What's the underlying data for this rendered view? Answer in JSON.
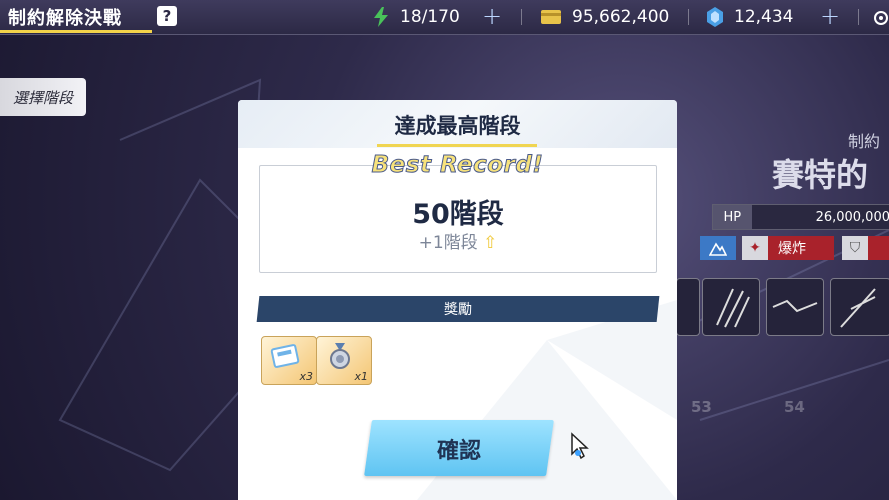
{
  "header": {
    "title": "制約解除決戰",
    "help_label": "?",
    "stamina": "18/170",
    "currency": "95,662,400",
    "gems": "12,434",
    "plus_label": "+"
  },
  "left_tab": {
    "label": "選擇階段"
  },
  "right_panel": {
    "subtitle": "制約",
    "boss_name": "賽特的",
    "hp_label": "HP",
    "hp_value": "26,000,000",
    "element_tag": "爆炸",
    "stage_numbers": [
      "53",
      "54"
    ]
  },
  "modal": {
    "title": "達成最高階段",
    "best_record": "Best Record!",
    "stage": "50階段",
    "delta": "+1階段",
    "reward_header": "獎勵",
    "rewards": [
      {
        "name": "ticket-icon",
        "count": "x3"
      },
      {
        "name": "medal-icon",
        "count": "x1"
      }
    ],
    "confirm_label": "確認"
  },
  "colors": {
    "accent_yellow": "#f3d34a",
    "reward_bar": "#2b4569",
    "confirm_button": "#7fd4f8",
    "hp_red": "#a9222b"
  }
}
